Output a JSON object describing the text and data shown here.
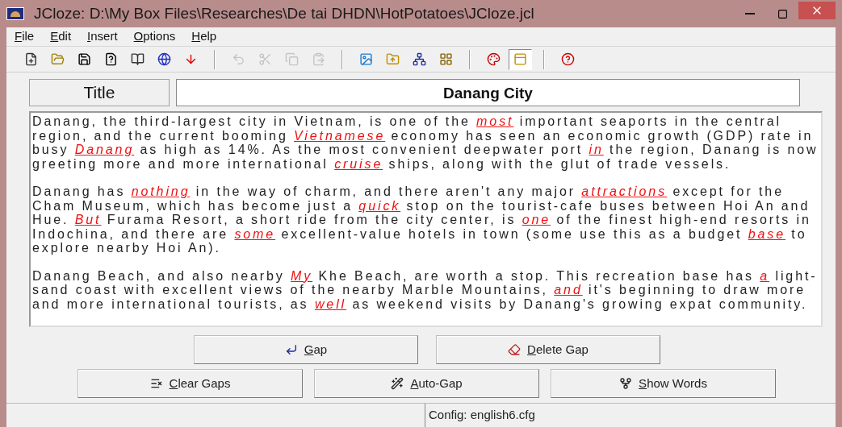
{
  "window": {
    "title": "JCloze: D:\\My Box Files\\Researches\\De tai DHDN\\HotPotatoes\\JCloze.jcl"
  },
  "menu": [
    "File",
    "Edit",
    "Insert",
    "Options",
    "Help"
  ],
  "toolbar": [
    [
      {
        "kind": "new",
        "disabled": false,
        "pressed": false
      },
      {
        "kind": "open",
        "disabled": false,
        "pressed": false
      },
      {
        "kind": "save",
        "disabled": false,
        "pressed": false
      },
      {
        "kind": "saveas",
        "disabled": false,
        "pressed": false
      },
      {
        "kind": "book",
        "disabled": false,
        "pressed": false
      },
      {
        "kind": "web",
        "disabled": false,
        "pressed": false
      },
      {
        "kind": "down",
        "disabled": false,
        "pressed": false
      }
    ],
    [
      {
        "kind": "undo",
        "disabled": true,
        "pressed": false
      },
      {
        "kind": "cut",
        "disabled": true,
        "pressed": false
      },
      {
        "kind": "copy",
        "disabled": true,
        "pressed": false
      },
      {
        "kind": "paste",
        "disabled": true,
        "pressed": false
      }
    ],
    [
      {
        "kind": "export1",
        "disabled": false,
        "pressed": false
      },
      {
        "kind": "export2",
        "disabled": false,
        "pressed": false
      },
      {
        "kind": "export3",
        "disabled": false,
        "pressed": false
      },
      {
        "kind": "export4",
        "disabled": false,
        "pressed": false
      }
    ],
    [
      {
        "kind": "config",
        "disabled": false,
        "pressed": false
      },
      {
        "kind": "dock",
        "disabled": false,
        "pressed": true
      }
    ],
    [
      {
        "kind": "help",
        "disabled": false,
        "pressed": false
      }
    ]
  ],
  "title_label": "Title",
  "title_value": "Danang City",
  "paragraphs": [
    [
      {
        "text": "Danang, the third-largest city in Vietnam, is one of the ",
        "gap": false
      },
      {
        "text": "most",
        "gap": true
      },
      {
        "text": " important seaports in the central region, and the current booming ",
        "gap": false
      },
      {
        "text": "Vietnamese",
        "gap": true
      },
      {
        "text": " economy has seen an economic growth (GDP) rate in busy ",
        "gap": false
      },
      {
        "text": "Danang",
        "gap": true
      },
      {
        "text": " as high as 14%. As the most convenient deepwater port ",
        "gap": false
      },
      {
        "text": "in",
        "gap": true
      },
      {
        "text": " the region, Danang is now greeting more and more international ",
        "gap": false
      },
      {
        "text": "cruise",
        "gap": true
      },
      {
        "text": " ships, along with the glut of trade vessels.",
        "gap": false
      }
    ],
    [
      {
        "text": "Danang has ",
        "gap": false
      },
      {
        "text": "nothing",
        "gap": true
      },
      {
        "text": " in the way of charm, and there aren't any major ",
        "gap": false
      },
      {
        "text": "attractions",
        "gap": true
      },
      {
        "text": " except for the Cham Museum, which has become just a ",
        "gap": false
      },
      {
        "text": "quick",
        "gap": true
      },
      {
        "text": " stop on the tourist-cafe buses between Hoi An and Hue. ",
        "gap": false
      },
      {
        "text": "But",
        "gap": true
      },
      {
        "text": " Furama Resort, a short ride from the city center, is ",
        "gap": false
      },
      {
        "text": "one",
        "gap": true
      },
      {
        "text": " of the finest high-end resorts in Indochina, and there are ",
        "gap": false
      },
      {
        "text": "some",
        "gap": true
      },
      {
        "text": " excellent-value hotels in town (some use this as a budget ",
        "gap": false
      },
      {
        "text": "base",
        "gap": true
      },
      {
        "text": " to explore nearby Hoi An).",
        "gap": false
      }
    ],
    [
      {
        "text": "Danang Beach, and also nearby ",
        "gap": false
      },
      {
        "text": "My",
        "gap": true
      },
      {
        "text": " Khe Beach, are worth a stop. This recreation base has ",
        "gap": false
      },
      {
        "text": "a",
        "gap": true
      },
      {
        "text": " light-sand coast with excellent views of the nearby Marble Mountains, ",
        "gap": false
      },
      {
        "text": "and",
        "gap": true
      },
      {
        "text": " it's beginning to draw more and more international tourists, as ",
        "gap": false
      },
      {
        "text": "well",
        "gap": true
      },
      {
        "text": " as weekend visits by Danang's growing expat community.",
        "gap": false
      }
    ]
  ],
  "buttons_row1": [
    {
      "kind": "gap",
      "label": "Gap"
    },
    {
      "kind": "delete",
      "label": "Delete Gap"
    }
  ],
  "buttons_row2": [
    {
      "kind": "clear",
      "label": "Clear Gaps"
    },
    {
      "kind": "auto",
      "label": "Auto-Gap"
    },
    {
      "kind": "show",
      "label": "Show Words"
    }
  ],
  "status_bar": "Config: english6.cfg"
}
